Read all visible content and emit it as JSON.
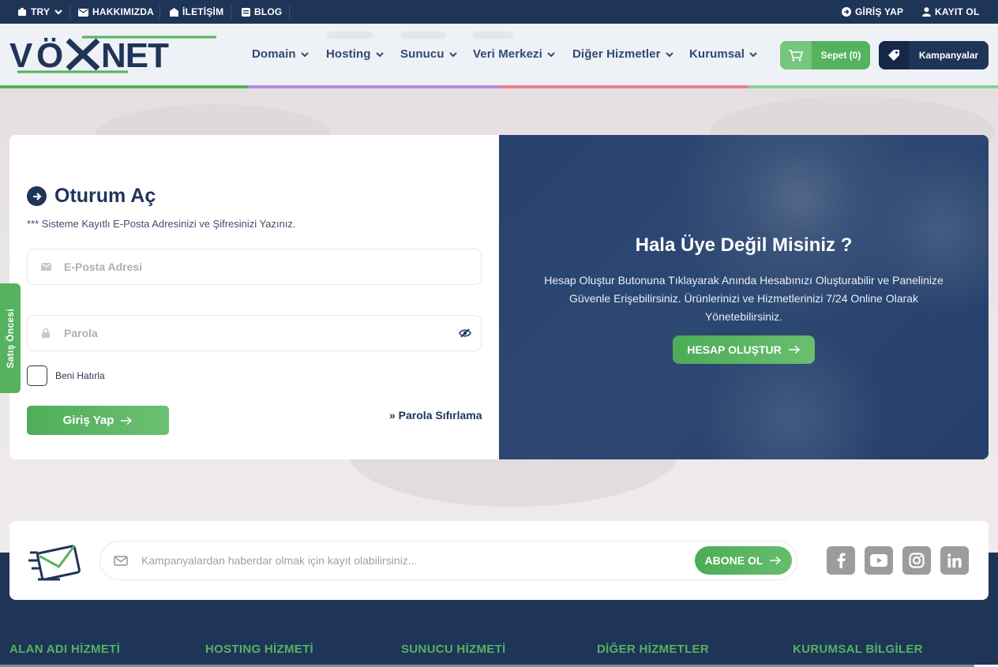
{
  "topbar": {
    "currency": "TRY",
    "about": "HAKKIMIZDA",
    "contact": "İLETİŞİM",
    "blog": "BLOG",
    "login": "GİRİŞ YAP",
    "register": "KAYIT OL"
  },
  "brand": {
    "logo_text": "VÖXNET",
    "color_dark": "#1e3558",
    "color_green": "#55b25f"
  },
  "nav": {
    "items": [
      "Domain",
      "Hosting",
      "Sunucu",
      "Veri Merkezi",
      "Diğer Hizmetler",
      "Kurumsal"
    ],
    "cart": "Sepet (0)",
    "campaigns": "Kampanyalar"
  },
  "login": {
    "title": "Oturum Aç",
    "subtitle": "*** Sisteme Kayıtlı E-Posta Adresinizi ve Şifresinizi Yazınız.",
    "email_placeholder": "E-Posta Adresi",
    "password_placeholder": "Parola",
    "remember": "Beni Hatırla",
    "submit": "Giriş Yap",
    "reset": "» Parola Sıfırlama"
  },
  "register": {
    "title": "Hala Üye Değil Misiniz ?",
    "text": "Hesap Oluştur Butonuna Tıklayarak Anında Hesabınızı Oluşturabilir ve Panelinize Güvenle Erişebilirsiniz. Ürünlerinizi ve Hizmetlerinizi 7/24 Online Olarak Yönetebilirsiniz.",
    "button": "HESAP OLUŞTUR"
  },
  "side_tab": "Satış Öncesi",
  "newsletter": {
    "placeholder": "Kampanyalardan haberdar olmak için kayıt olabilirsiniz...",
    "button": "ABONE OL"
  },
  "social": [
    "facebook-icon",
    "youtube-icon",
    "instagram-icon",
    "linkedin-icon"
  ],
  "footer": {
    "columns": [
      "ALAN ADI HİZMETİ",
      "HOSTING HİZMETİ",
      "SUNUCU HİZMETİ",
      "DİĞER HİZMETLER",
      "KURUMSAL BİLGİLER"
    ]
  }
}
